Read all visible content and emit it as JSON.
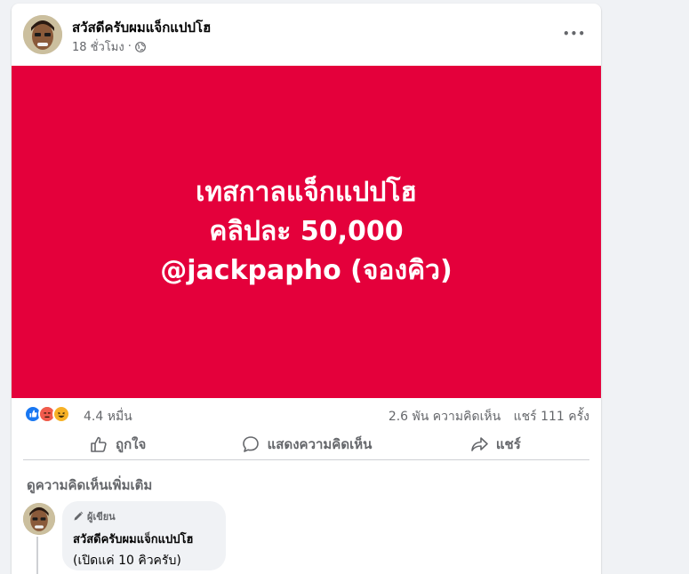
{
  "post": {
    "author_name": "สวัสดีครับผมแจ็กแปปโฮ",
    "time": "18 ชั่วโมง",
    "separator": "·",
    "privacy_icon": "globe-icon",
    "more_icon": "ellipsis-icon",
    "more_label": "•••",
    "banner": {
      "background": "#e4003b",
      "line1": "เทสกาลแจ็กแปปโฮ",
      "line2": "คลิปละ 50,000",
      "line3": "@jackpapho (จองคิว)"
    }
  },
  "stats": {
    "reactions": [
      "like",
      "angry",
      "haha"
    ],
    "reaction_count": "4.4 หมื่น",
    "comments": "2.6 พัน ความคิดเห็น",
    "shares": "แชร์ 111 ครั้ง"
  },
  "actions": {
    "like": "ถูกใจ",
    "comment": "แสดงความคิดเห็น",
    "share": "แชร์"
  },
  "comments": {
    "more_label": "ดูความคิดเห็นเพิ่มเติม",
    "items": [
      {
        "badge": "ผู้เขียน",
        "author": "สวัสดีครับผมแจ็กแปปโฮ",
        "text": "(เปิดแค่ 10 คิวครับ)"
      }
    ]
  },
  "colors": {
    "brand_blue": "#1877f2",
    "banner_red": "#e4003b",
    "secondary_text": "#65676b"
  }
}
